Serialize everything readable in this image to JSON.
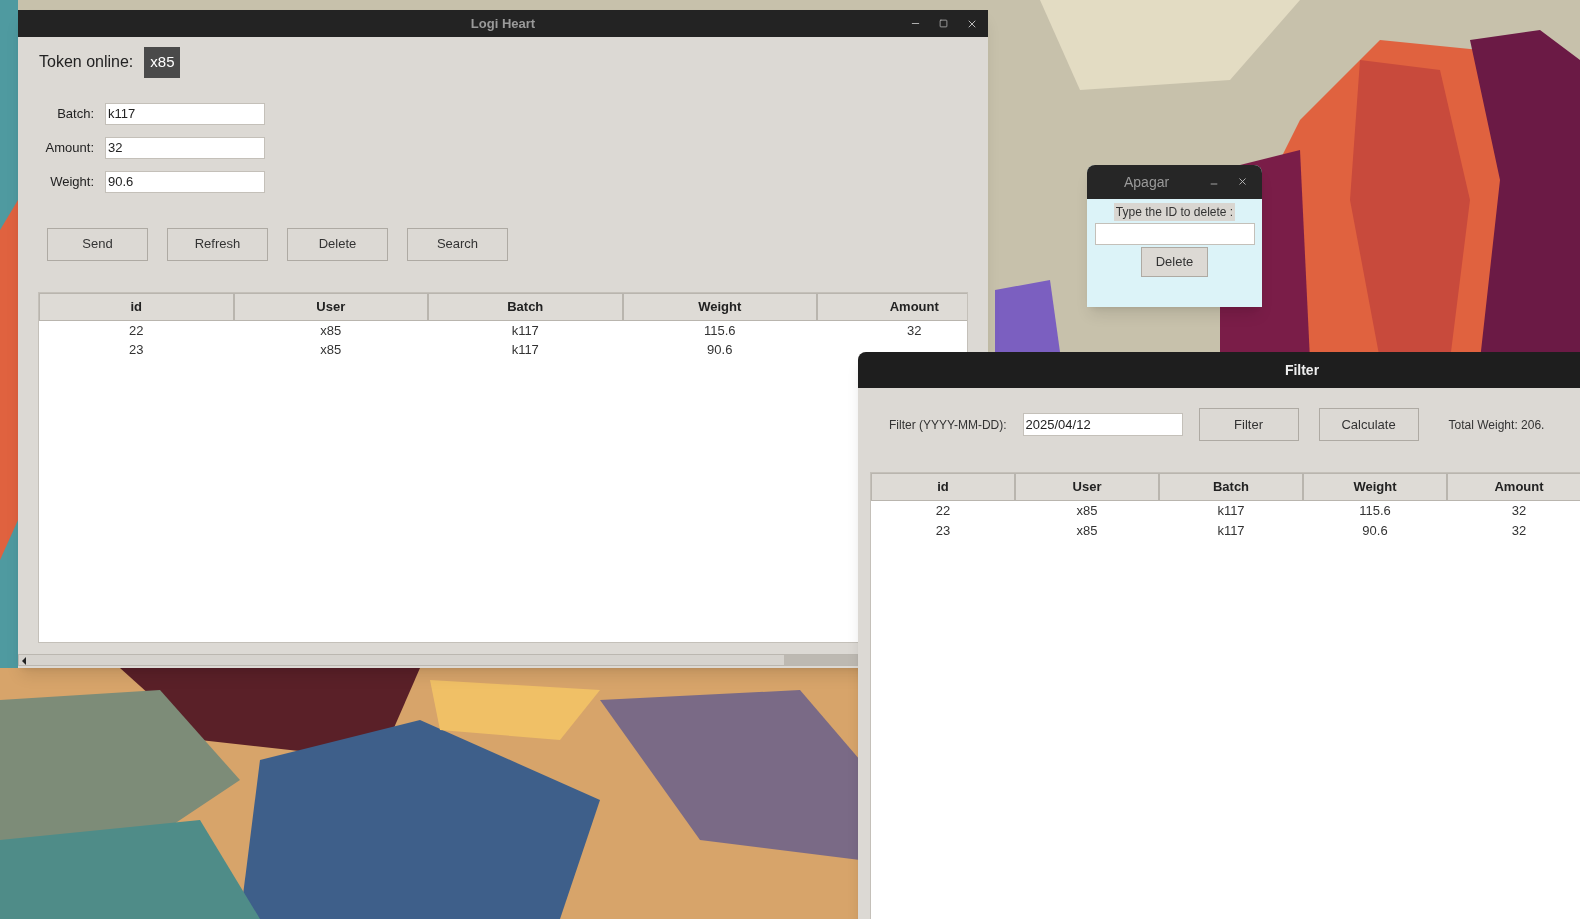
{
  "main_window": {
    "title": "Logi Heart",
    "token_label": "Token online:",
    "token": "x85",
    "fields": [
      {
        "label": "Batch:",
        "value": "k117"
      },
      {
        "label": "Amount:",
        "value": "32"
      },
      {
        "label": "Weight:",
        "value": "90.6"
      }
    ],
    "buttons": [
      "Send",
      "Refresh",
      "Delete",
      "Search"
    ],
    "table": {
      "columns": [
        "id",
        "User",
        "Batch",
        "Weight",
        "Amount"
      ],
      "rows": [
        [
          "22",
          "x85",
          "k117",
          "115.6",
          "32"
        ],
        [
          "23",
          "x85",
          "k117",
          "90.6"
        ]
      ]
    }
  },
  "delete_dialog": {
    "title": "Apagar",
    "prompt": "Type the ID to delete :",
    "button": "Delete"
  },
  "filter_window": {
    "title": "Filter",
    "filter_label": "Filter (YYYY-MM-DD):",
    "filter_value": "2025/04/12",
    "buttons": [
      "Filter",
      "Calculate"
    ],
    "total": "Total Weight: 206.",
    "table": {
      "columns": [
        "id",
        "User",
        "Batch",
        "Weight",
        "Amount"
      ],
      "rows": [
        [
          "22",
          "x85",
          "k117",
          "115.6",
          "32"
        ],
        [
          "23",
          "x85",
          "k117",
          "90.6",
          "32"
        ]
      ]
    }
  }
}
